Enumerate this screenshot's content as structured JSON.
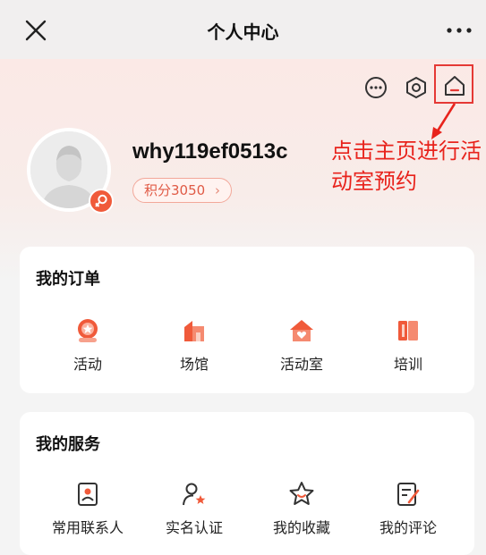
{
  "header": {
    "title": "个人中心",
    "close_icon": "close-icon",
    "more_icon": "more-icon"
  },
  "profile": {
    "username": "why119ef0513c",
    "points_label": "积分3050",
    "points_chevron": "›",
    "actions": [
      "message-icon",
      "settings-icon",
      "home-icon"
    ]
  },
  "annotation": {
    "text": "点击主页进行活动室预约",
    "color": "#e8231c"
  },
  "orders": {
    "title": "我的订单",
    "items": [
      {
        "label": "活动",
        "icon": "activity-icon"
      },
      {
        "label": "场馆",
        "icon": "venue-icon"
      },
      {
        "label": "活动室",
        "icon": "activity-room-icon"
      },
      {
        "label": "培训",
        "icon": "training-icon"
      }
    ]
  },
  "services": {
    "title": "我的服务",
    "items": [
      {
        "label": "常用联系人",
        "icon": "contacts-icon"
      },
      {
        "label": "实名认证",
        "icon": "verification-icon"
      },
      {
        "label": "我的收藏",
        "icon": "favorites-icon"
      },
      {
        "label": "我的评论",
        "icon": "comments-icon"
      }
    ]
  },
  "colors": {
    "accent": "#f05a3a",
    "highlight": "#e53935"
  }
}
